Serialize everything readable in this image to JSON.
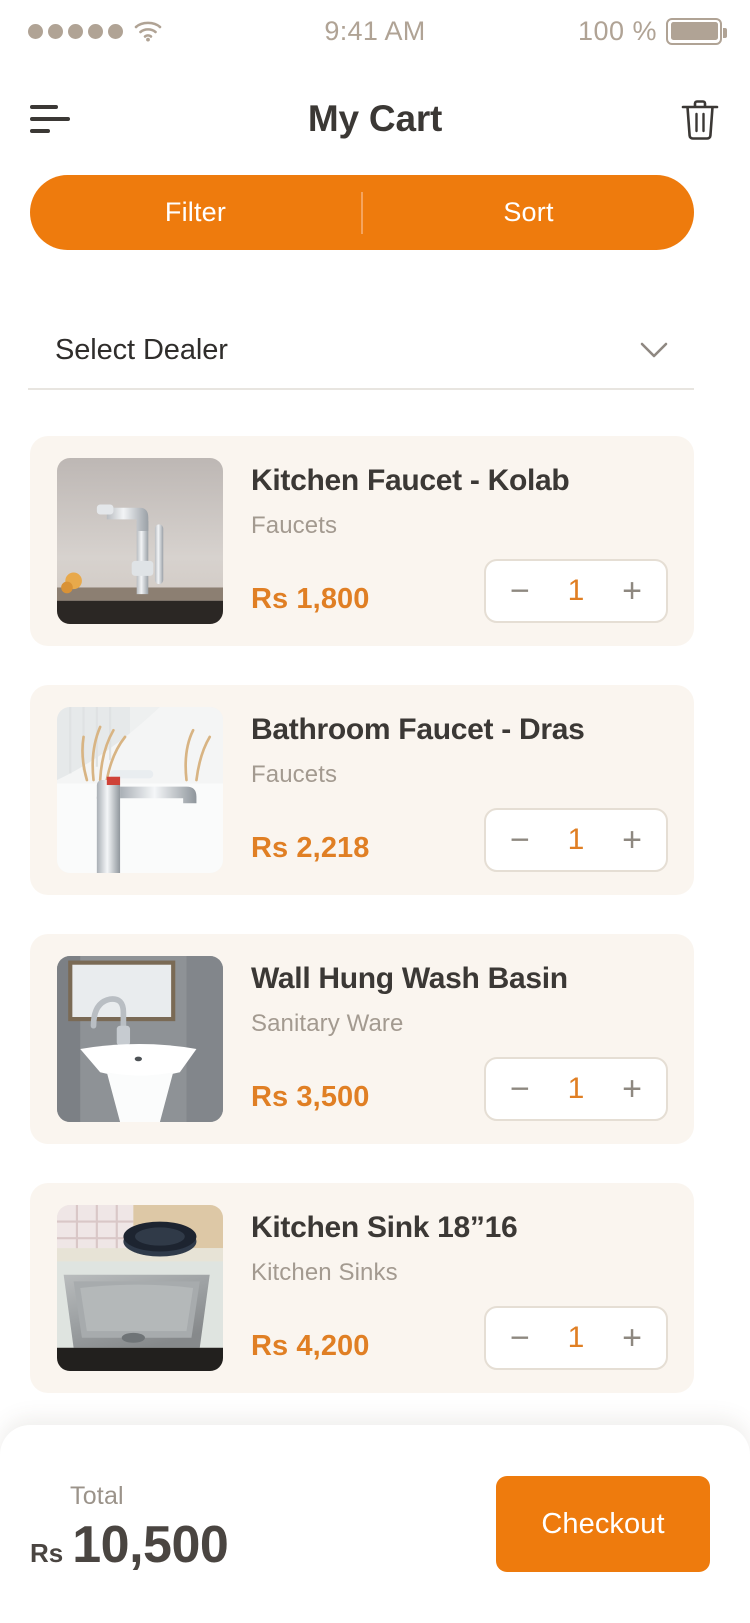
{
  "status_bar": {
    "signal_dots": 5,
    "wifi_icon": "wifi-icon",
    "time": "9:41 AM",
    "battery_percent": "100 %",
    "battery_icon": "battery-full-icon"
  },
  "header": {
    "menu_icon": "hamburger-menu-icon",
    "title": "My Cart",
    "trash_icon": "trash-icon"
  },
  "filter_sort": {
    "filter_label": "Filter",
    "sort_label": "Sort"
  },
  "dealer": {
    "label": "Select Dealer",
    "chevron_icon": "chevron-down-icon"
  },
  "cart_items": [
    {
      "title": "Kitchen Faucet - Kolab",
      "category": "Faucets",
      "price": "Rs 1,800",
      "quantity": "1",
      "decrement_label": "−",
      "increment_label": "+",
      "image_alt": "kitchen-faucet-photo"
    },
    {
      "title": "Bathroom Faucet - Dras",
      "category": "Faucets",
      "price": "Rs 2,218",
      "quantity": "1",
      "decrement_label": "−",
      "increment_label": "+",
      "image_alt": "bathroom-faucet-photo"
    },
    {
      "title": "Wall Hung Wash Basin",
      "category": "Sanitary Ware",
      "price": "Rs 3,500",
      "quantity": "1",
      "decrement_label": "−",
      "increment_label": "+",
      "image_alt": "wall-hung-wash-basin-photo"
    },
    {
      "title": "Kitchen Sink 18”16",
      "category": "Kitchen Sinks",
      "price": "Rs 4,200",
      "quantity": "1",
      "decrement_label": "−",
      "increment_label": "+",
      "image_alt": "kitchen-sink-photo"
    }
  ],
  "bottom_bar": {
    "total_label": "Total",
    "total_currency": "Rs",
    "total_value": "10,500",
    "checkout_label": "Checkout"
  },
  "colors": {
    "accent_orange": "#ee7b0d",
    "price_orange": "#e07f24",
    "card_bg": "#faf5ef",
    "title_dark": "#3b3835",
    "muted_gray": "#a39a90",
    "status_tan": "#b0a395"
  }
}
